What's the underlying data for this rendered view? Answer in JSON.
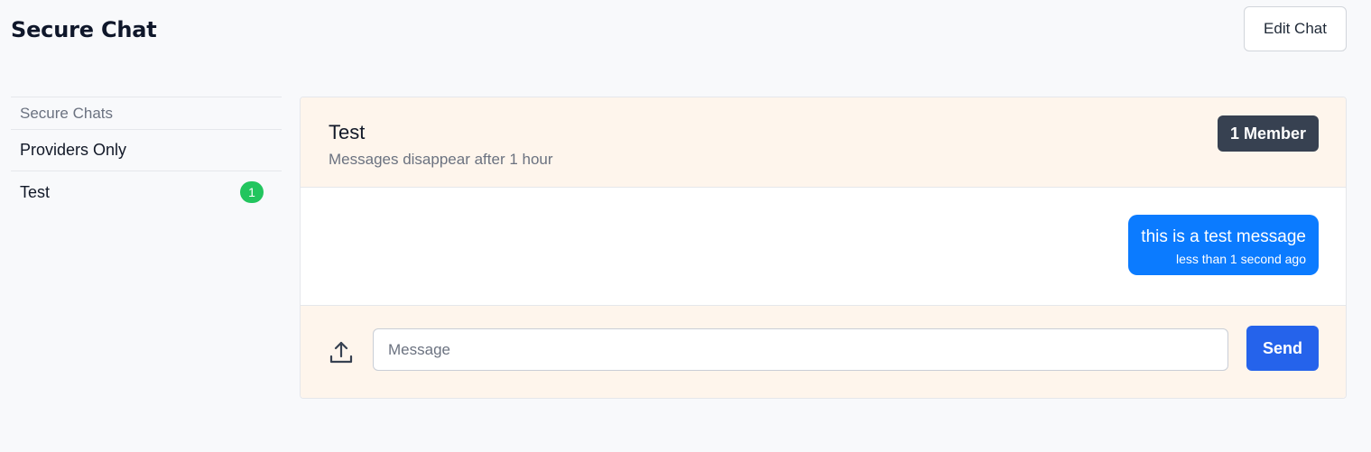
{
  "header": {
    "title": "Secure Chat",
    "edit_button_label": "Edit Chat"
  },
  "sidebar": {
    "heading": "Secure Chats",
    "items": [
      {
        "label": "Providers Only",
        "unread": null
      },
      {
        "label": "Test",
        "unread": "1"
      }
    ]
  },
  "chat": {
    "title": "Test",
    "subtitle": "Messages disappear after 1 hour",
    "member_badge": "1 Member",
    "messages": [
      {
        "text": "this is a test message",
        "time": "less than 1 second ago"
      }
    ]
  },
  "composer": {
    "upload_icon": "upload-icon",
    "placeholder": "Message",
    "value": "",
    "send_label": "Send"
  },
  "colors": {
    "background": "#f8f9fb",
    "panel_tint": "#fef5ec",
    "bubble": "#0b7bff",
    "send": "#2563eb",
    "badge_dark": "#374151",
    "unread_badge": "#22c55e"
  }
}
